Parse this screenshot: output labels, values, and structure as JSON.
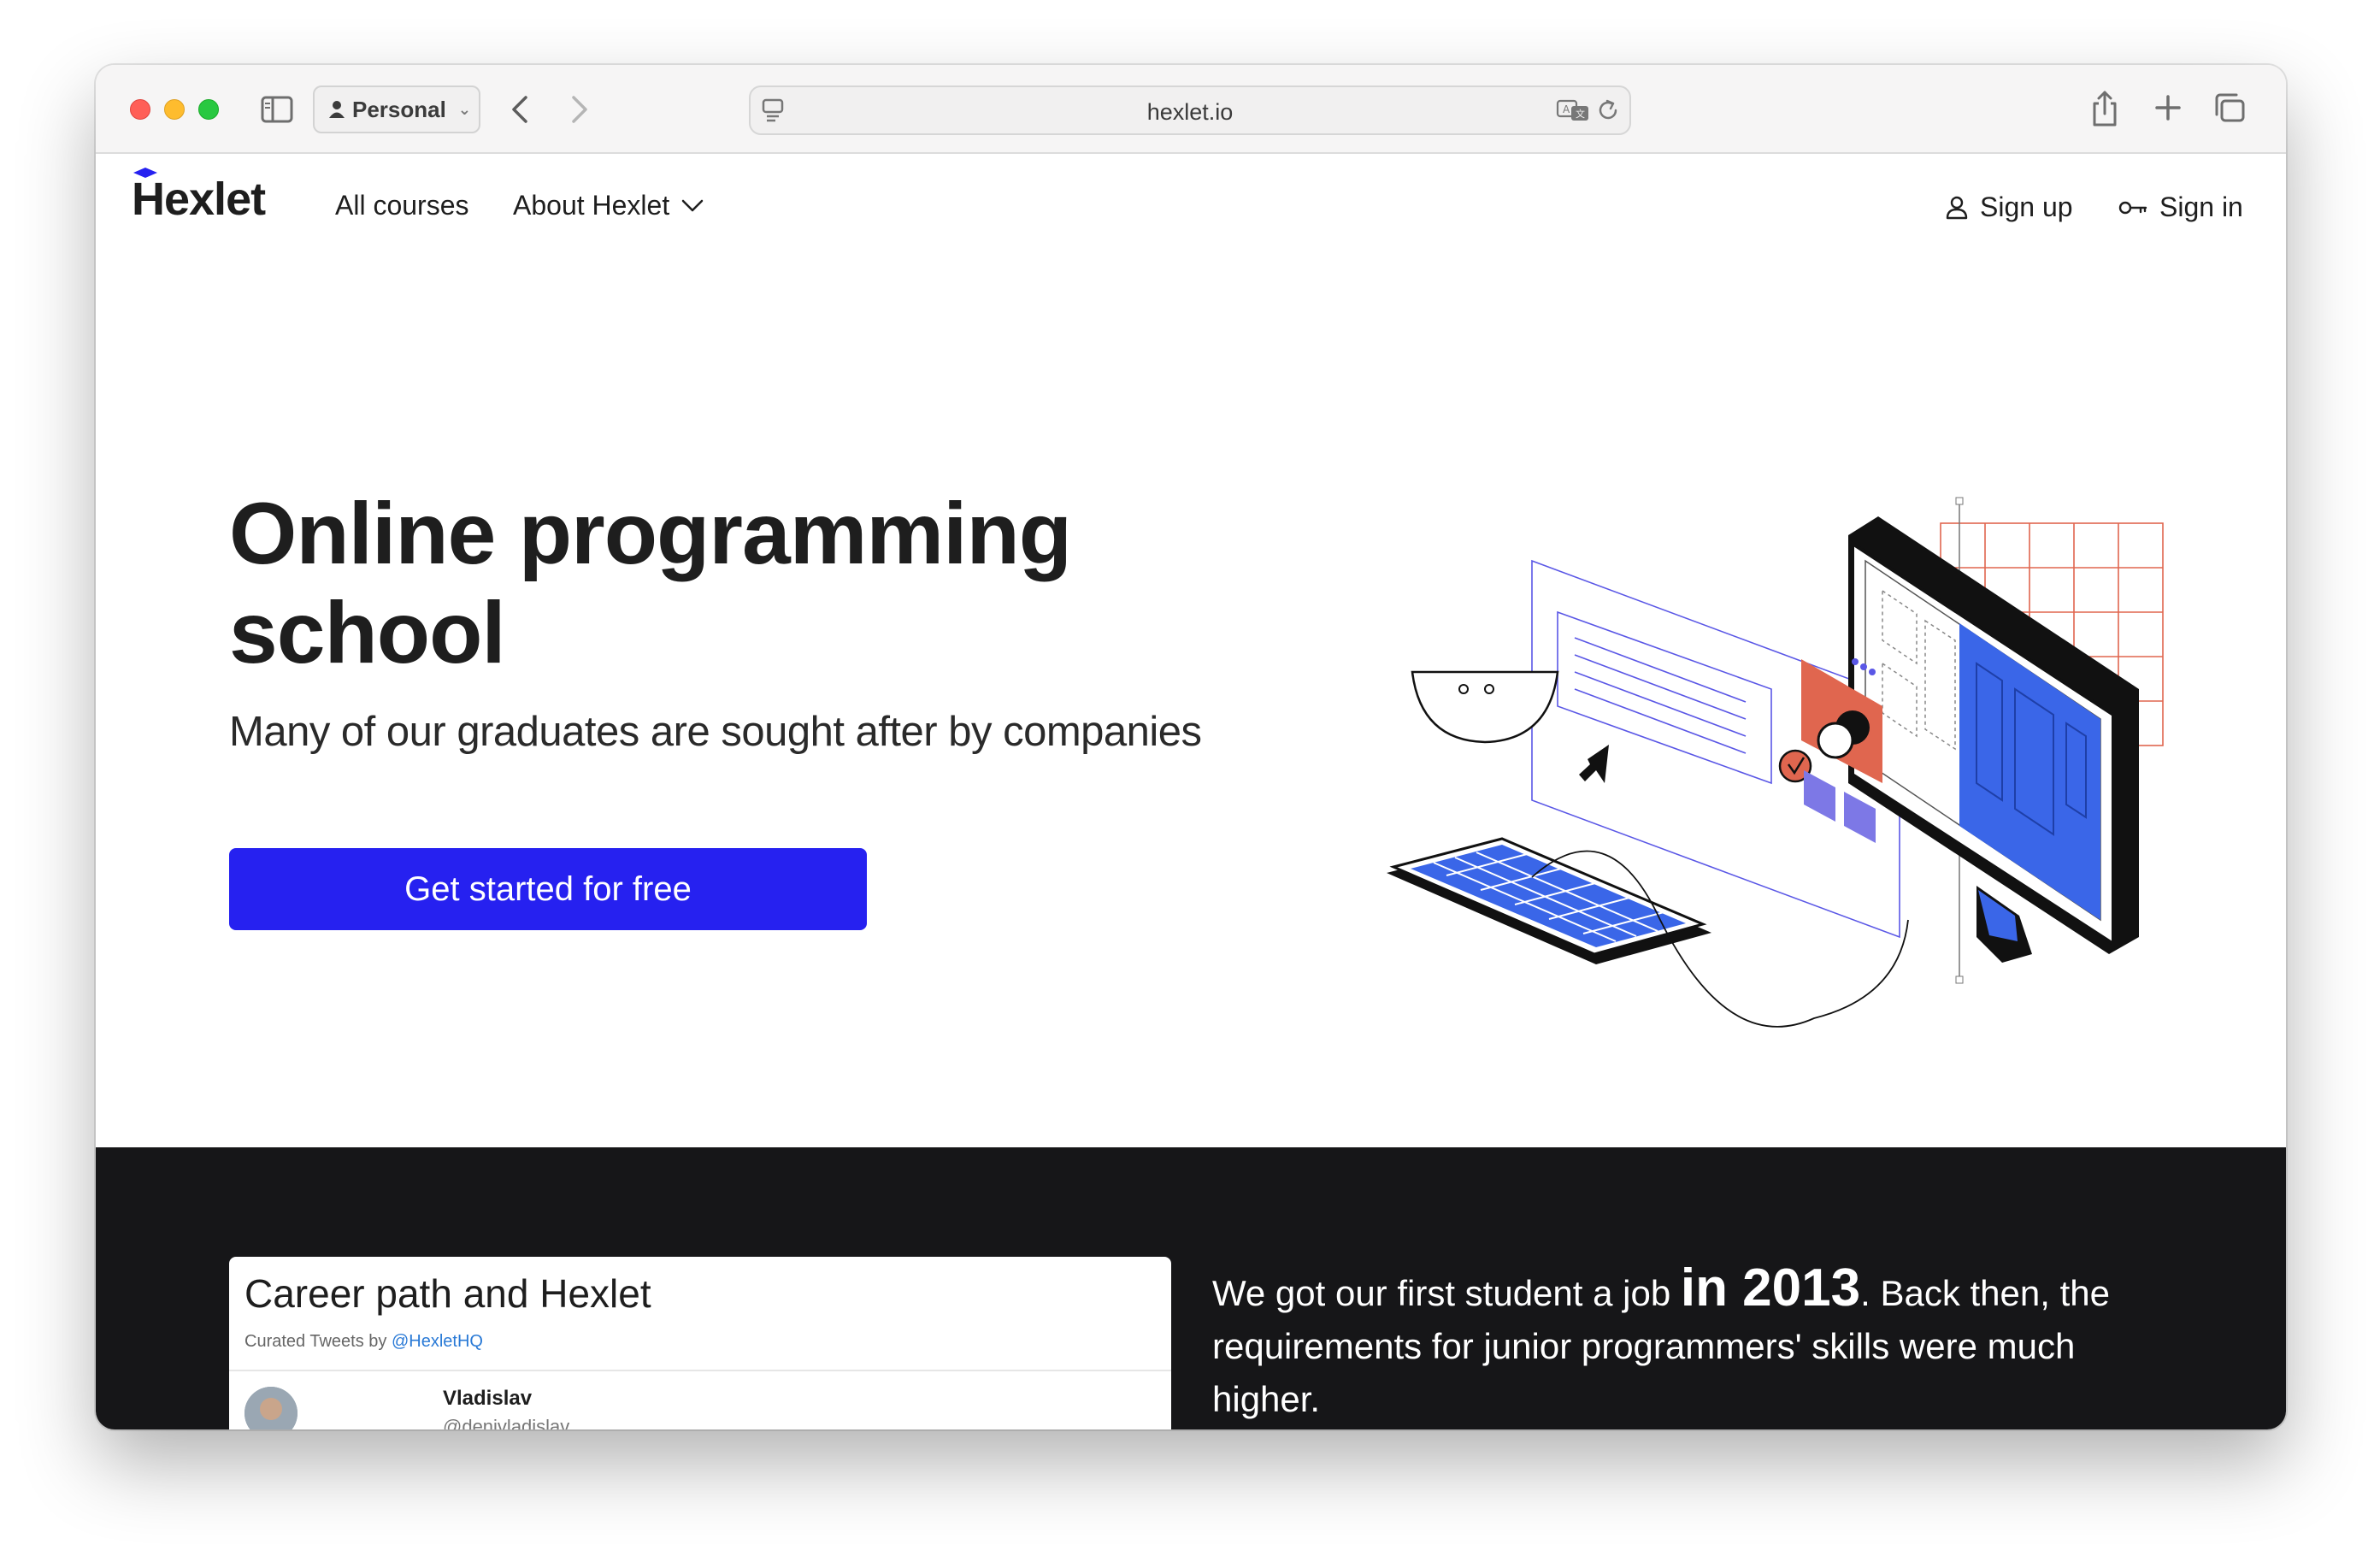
{
  "browser": {
    "profile": "Personal",
    "url": "hexlet.io"
  },
  "site": {
    "logo": "Hexlet",
    "nav": {
      "all_courses": "All courses",
      "about": "About Hexlet"
    },
    "auth": {
      "sign_up": "Sign up",
      "sign_in": "Sign in"
    }
  },
  "hero": {
    "title": "Online programming school",
    "subtitle": "Many of our graduates are sought after by companies",
    "cta": "Get started for free"
  },
  "career": {
    "title": "Career path and Hexlet",
    "curated_prefix": "Curated Tweets by ",
    "curated_handle": "@HexletHQ",
    "tweet_name": "Vladislav",
    "tweet_handle": "@denivladislav",
    "story_before": "We got our first student a job ",
    "story_year": "in 2013",
    "story_after": ". Back then, the requirements for junior programmers' skills were much higher."
  },
  "colors": {
    "brand_blue": "#2621f0",
    "dark_bg": "#161618",
    "accent_red": "#e0664f",
    "accent_blue": "#3a66e8",
    "accent_purple": "#7d78e6"
  }
}
